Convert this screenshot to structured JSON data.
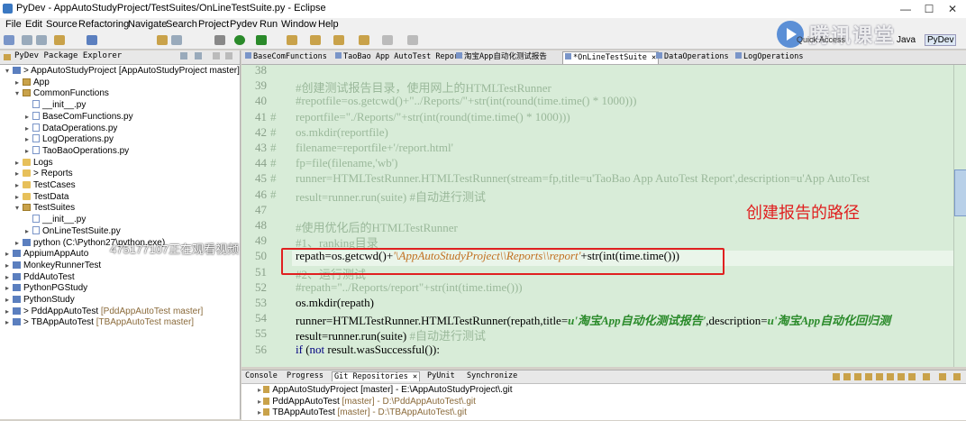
{
  "window": {
    "title": "PyDev - AppAutoStudyProject/TestSuites/OnLineTestSuite.py - Eclipse",
    "minimize": "—",
    "maximize": "☐",
    "close": "✕"
  },
  "menu": [
    "File",
    "Edit",
    "Source",
    "Refactoring",
    "Navigate",
    "Search",
    "Project",
    "Pydev",
    "Run",
    "Window",
    "Help"
  ],
  "watermark": {
    "brand": "腾讯课堂",
    "quick_access": "Quick Access",
    "perspectives": [
      "Java",
      "PyDev"
    ]
  },
  "left_panel": {
    "tab_label": "PyDev Package Explorer",
    "watching_note": "475177107正在观看视频",
    "tree": [
      {
        "indent": 0,
        "type": "proj",
        "twisty": "v",
        "label": "> AppAutoStudyProject [AppAutoStudyProject master]"
      },
      {
        "indent": 1,
        "type": "pkg",
        "twisty": ">",
        "label": "App"
      },
      {
        "indent": 1,
        "type": "pkg",
        "twisty": "v",
        "label": "CommonFunctions"
      },
      {
        "indent": 2,
        "type": "py",
        "twisty": "",
        "label": "__init__.py"
      },
      {
        "indent": 2,
        "type": "py",
        "twisty": ">",
        "label": "BaseComFunctions.py"
      },
      {
        "indent": 2,
        "type": "py",
        "twisty": ">",
        "label": "DataOperations.py"
      },
      {
        "indent": 2,
        "type": "py",
        "twisty": ">",
        "label": "LogOperations.py"
      },
      {
        "indent": 2,
        "type": "py",
        "twisty": ">",
        "label": "TaoBaoOperations.py"
      },
      {
        "indent": 1,
        "type": "folder",
        "twisty": ">",
        "label": "Logs"
      },
      {
        "indent": 1,
        "type": "folder",
        "twisty": ">",
        "label": "> Reports"
      },
      {
        "indent": 1,
        "type": "folder",
        "twisty": ">",
        "label": "TestCases"
      },
      {
        "indent": 1,
        "type": "folder",
        "twisty": ">",
        "label": "TestData"
      },
      {
        "indent": 1,
        "type": "pkg",
        "twisty": "v",
        "label": "TestSuites"
      },
      {
        "indent": 2,
        "type": "py",
        "twisty": "",
        "label": "__init__.py"
      },
      {
        "indent": 2,
        "type": "py",
        "twisty": ">",
        "label": "OnLineTestSuite.py"
      },
      {
        "indent": 1,
        "type": "python",
        "twisty": ">",
        "label": "python  (C:\\Python27\\python.exe)"
      },
      {
        "indent": 0,
        "type": "proj",
        "twisty": ">",
        "label": "AppiumAppAuto"
      },
      {
        "indent": 0,
        "type": "proj",
        "twisty": ">",
        "label": "MonkeyRunnerTest"
      },
      {
        "indent": 0,
        "type": "proj",
        "twisty": ">",
        "label": "PddAutoTest"
      },
      {
        "indent": 0,
        "type": "proj",
        "twisty": ">",
        "label": "PythonPGStudy"
      },
      {
        "indent": 0,
        "type": "proj",
        "twisty": ">",
        "label": "PythonStudy"
      },
      {
        "indent": 0,
        "type": "proj",
        "twisty": ">",
        "label": "> PddAppAutoTest",
        "sub": " [PddAppAutoTest master]"
      },
      {
        "indent": 0,
        "type": "proj",
        "twisty": ">",
        "label": "> TBAppAutoTest",
        "sub": " [TBAppAutoTest master]"
      }
    ]
  },
  "editor_tabs": [
    {
      "label": "BaseComFunctions",
      "active": false
    },
    {
      "label": "TaoBao App AutoTest Report",
      "active": false
    },
    {
      "label": "淘宝App自动化测试报告",
      "active": false
    },
    {
      "label": "*OnLineTestSuite ✕",
      "active": true
    },
    {
      "label": "DataOperations",
      "active": false
    },
    {
      "label": "LogOperations",
      "active": false
    }
  ],
  "editor": {
    "lines": [
      {
        "no": "38",
        "hash": "",
        "kind": "cmt",
        "text": ""
      },
      {
        "no": "39",
        "hash": "",
        "kind": "cmt",
        "text": "#创建测试报告目录，使用网上的HTMLTestRunner"
      },
      {
        "no": "40",
        "hash": "",
        "kind": "cmt",
        "text": "#repotfile=os.getcwd()+\"../Reports/\"+str(int(round(time.time() * 1000)))"
      },
      {
        "no": "41",
        "hash": "#",
        "kind": "cmt",
        "text": "    reportfile=\"./Reports/\"+str(int(round(time.time() * 1000)))"
      },
      {
        "no": "42",
        "hash": "#",
        "kind": "cmt",
        "text": "    os.mkdir(reportfile)"
      },
      {
        "no": "43",
        "hash": "#",
        "kind": "cmt",
        "text": "    filename=reportfile+'/report.html'"
      },
      {
        "no": "44",
        "hash": "#",
        "kind": "cmt",
        "text": "    fp=file(filename,'wb')"
      },
      {
        "no": "45",
        "hash": "#",
        "kind": "cmt",
        "text": "    runner=HTMLTestRunner.HTMLTestRunner(stream=fp,title=u'TaoBao App AutoTest Report',description=u'App AutoTest"
      },
      {
        "no": "46",
        "hash": "#",
        "kind": "cmt",
        "text": "    result=runner.run(suite) #自动进行测试"
      },
      {
        "no": "47",
        "hash": "",
        "kind": "cmt",
        "text": ""
      },
      {
        "no": "48",
        "hash": "",
        "kind": "cmt",
        "text": "#使用优化后的HTMLTestRunner"
      },
      {
        "no": "49",
        "hash": "",
        "kind": "cmt",
        "text": "#1、ranking目录"
      },
      {
        "no": "50",
        "hash": "",
        "kind": "cur",
        "pre": "repath=os.getcwd()+",
        "str": "'\\AppAutoStudyProject\\\\Reports\\\\report'",
        "post": "+str(int(time.time()))"
      },
      {
        "no": "51",
        "hash": "",
        "kind": "cmt",
        "text": "#2、运行测试"
      },
      {
        "no": "52",
        "hash": "",
        "kind": "cmt",
        "text": "#repath=\"../Reports/report\"+str(int(time.time()))"
      },
      {
        "no": "53",
        "hash": "",
        "kind": "dark",
        "text": "os.mkdir(repath)"
      },
      {
        "no": "54",
        "hash": "",
        "kind": "runner",
        "pre": "runner=HTMLTestRunner.HTMLTestRunner(repath,title=",
        "str": "u'淘宝App自动化测试报告'",
        "mid": ",description=",
        "str2": "u'淘宝App自动化回归测"
      },
      {
        "no": "55",
        "hash": "",
        "kind": "mixed",
        "pre": "result=runner.run(suite) ",
        "cmt": "#自动进行测试"
      },
      {
        "no": "56",
        "hash": "",
        "kind": "ifline",
        "kw": "if",
        "pre": " (",
        "kw2": "not",
        "post": " result.wasSuccessful()):"
      }
    ],
    "annotation": "创建报告的路径"
  },
  "bottom_panel": {
    "tabs": [
      {
        "label": "Console",
        "active": false
      },
      {
        "label": "Progress",
        "active": false
      },
      {
        "label": "Git Repositories ✕",
        "active": true
      },
      {
        "label": "PyUnit",
        "active": false
      },
      {
        "label": "Synchronize",
        "active": false
      }
    ],
    "repos": [
      {
        "name": "AppAutoStudyProject [master] - E:\\AppAutoStudyProject\\.git",
        "sub": ""
      },
      {
        "name": "PddAppAutoTest",
        "sub": " [master] - D:\\PddAppAutoTest\\.git"
      },
      {
        "name": "TBAppAutoTest",
        "sub": " [master] - D:\\TBAppAutoTest\\.git"
      }
    ]
  },
  "colors": {
    "editor_bg": "#d8ecd8",
    "comment": "#9ab89a",
    "highlight": "#e02020",
    "string": "#2a8a2a"
  }
}
